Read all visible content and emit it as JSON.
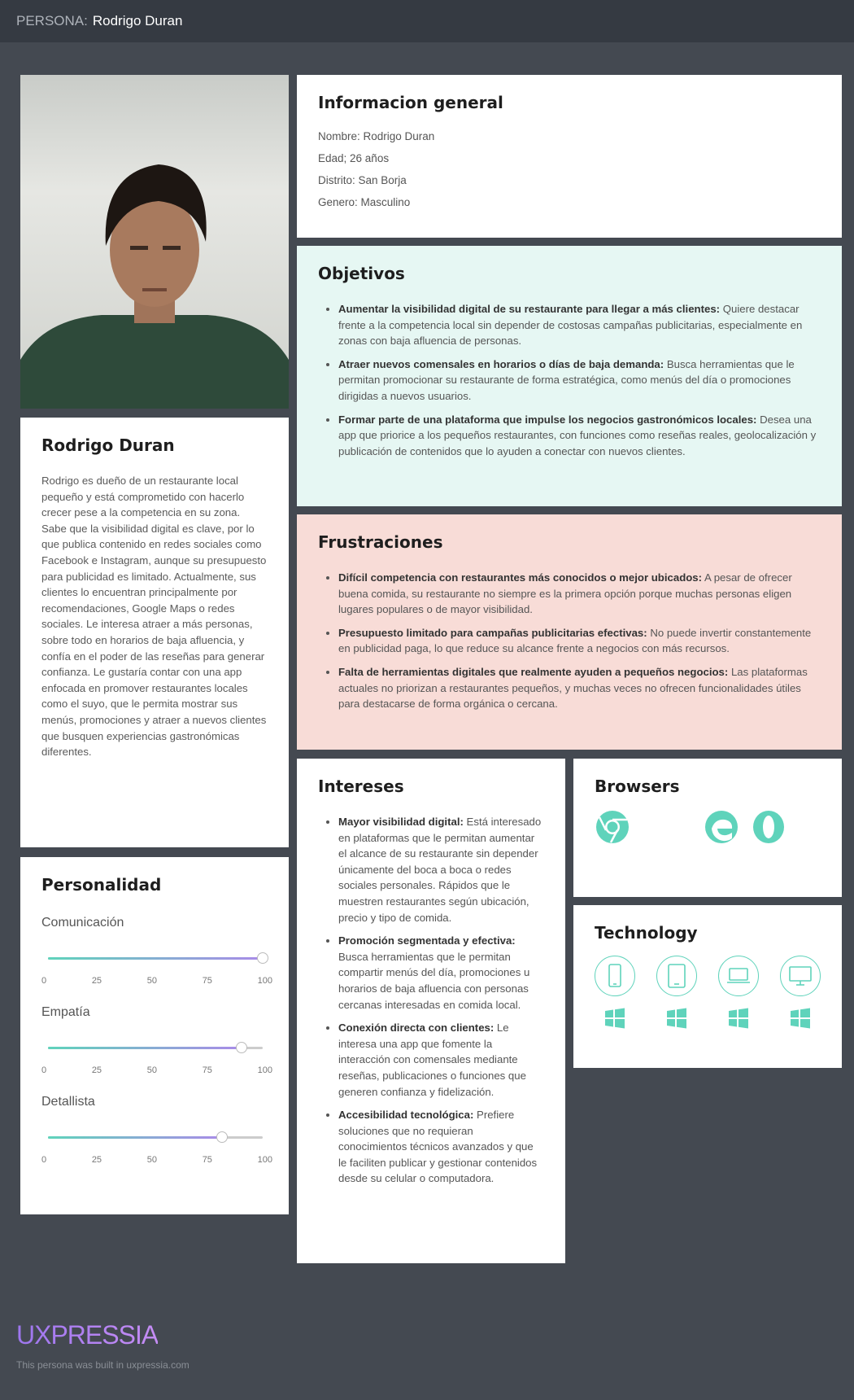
{
  "topbar": {
    "prefix": "PERSONA:",
    "name": "Rodrigo Duran"
  },
  "bio": {
    "name": "Rodrigo Duran",
    "text": "Rodrigo es dueño de un restaurante local pequeño y está comprometido con hacerlo crecer pese a la competencia en su zona. Sabe que la visibilidad digital es clave, por lo que publica contenido en redes sociales como Facebook e Instagram, aunque su presupuesto para publicidad es limitado. Actualmente, sus clientes lo encuentran principalmente por recomendaciones, Google Maps o redes sociales. Le interesa atraer a más personas, sobre todo en horarios de baja afluencia, y confía en el poder de las reseñas para generar confianza. Le gustaría contar con una app enfocada en promover restaurantes locales como el suyo, que le permita mostrar sus menús, promociones y atraer a nuevos clientes que busquen experiencias gastronómicas diferentes."
  },
  "personality": {
    "title": "Personalidad",
    "ticks": [
      "0",
      "25",
      "50",
      "75",
      "100"
    ],
    "sliders": [
      {
        "label": "Comunicación",
        "value": 100
      },
      {
        "label": "Empatía",
        "value": 90
      },
      {
        "label": "Detallista",
        "value": 81
      }
    ]
  },
  "info": {
    "title": "Informacion general",
    "rows": [
      "Nombre: Rodrigo Duran",
      "Edad; 26 años",
      "Distrito: San Borja",
      "Genero: Masculino"
    ]
  },
  "goals": {
    "title": "Objetivos",
    "items": [
      {
        "bold": "Aumentar la visibilidad digital de su restaurante para llegar a más clientes:",
        "text": " Quiere destacar frente a la competencia local sin depender de costosas campañas publicitarias, especialmente en zonas con baja afluencia de personas."
      },
      {
        "bold": "Atraer nuevos comensales en horarios o días de baja demanda:",
        "text": " Busca herramientas que le permitan promocionar su restaurante de forma estratégica, como menús del día o promociones dirigidas a nuevos usuarios."
      },
      {
        "bold": "Formar parte de una plataforma que impulse los negocios gastronómicos locales:",
        "text": " Desea una app que priorice a los pequeños restaurantes, con funciones como reseñas reales, geolocalización y publicación de contenidos que lo ayuden a conectar con nuevos clientes."
      }
    ]
  },
  "frustrations": {
    "title": "Frustraciones",
    "items": [
      {
        "bold": "Difícil competencia con restaurantes más conocidos o mejor ubicados:",
        "text": " A pesar de ofrecer buena comida, su restaurante no siempre es la primera opción porque muchas personas eligen lugares populares o de mayor visibilidad."
      },
      {
        "bold": "Presupuesto limitado para campañas publicitarias efectivas:",
        "text": " No puede invertir constantemente en publicidad paga, lo que reduce su alcance frente a negocios con más recursos."
      },
      {
        "bold": "Falta de herramientas digitales que realmente ayuden a pequeños negocios:",
        "text": " Las plataformas actuales no priorizan a restaurantes pequeños, y muchas veces no ofrecen funcionalidades útiles para destacarse de forma orgánica o cercana."
      }
    ]
  },
  "interests": {
    "title": "Intereses",
    "items": [
      {
        "bold": "Mayor visibilidad digital:",
        "text": " Está interesado en plataformas que le permitan aumentar el alcance de su restaurante sin depender únicamente del boca a boca o redes sociales personales. Rápidos que le muestren restaurantes según ubicación, precio y tipo de comida."
      },
      {
        "bold": "Promoción segmentada y efectiva:",
        "text": " Busca herramientas que le permitan compartir menús del día, promociones u horarios de baja afluencia con personas cercanas interesadas en comida local."
      },
      {
        "bold": "Conexión directa con clientes:",
        "text": " Le interesa una app que fomente la interacción con comensales mediante reseñas, publicaciones o funciones que generen confianza y fidelización."
      },
      {
        "bold": "Accesibilidad tecnológica:",
        "text": " Prefiere soluciones que no requieran conocimientos técnicos avanzados y que le faciliten publicar y gestionar contenidos desde su celular o computadora."
      }
    ]
  },
  "browsers": {
    "title": "Browsers",
    "icons": [
      "chrome-icon",
      "edge-icon",
      "opera-icon"
    ]
  },
  "technology": {
    "title": "Technology",
    "devices": [
      "phone-icon",
      "tablet-icon",
      "laptop-icon",
      "desktop-icon"
    ],
    "os": "windows-icon"
  },
  "footer": {
    "logo": "UXPRESSIA",
    "built": "This persona was built in uxpressia.com"
  },
  "colors": {
    "accent": "#5fd3bb",
    "purple": "#a98be8",
    "goals_bg": "#e6f7f3",
    "frus_bg": "#f8dcd7"
  }
}
